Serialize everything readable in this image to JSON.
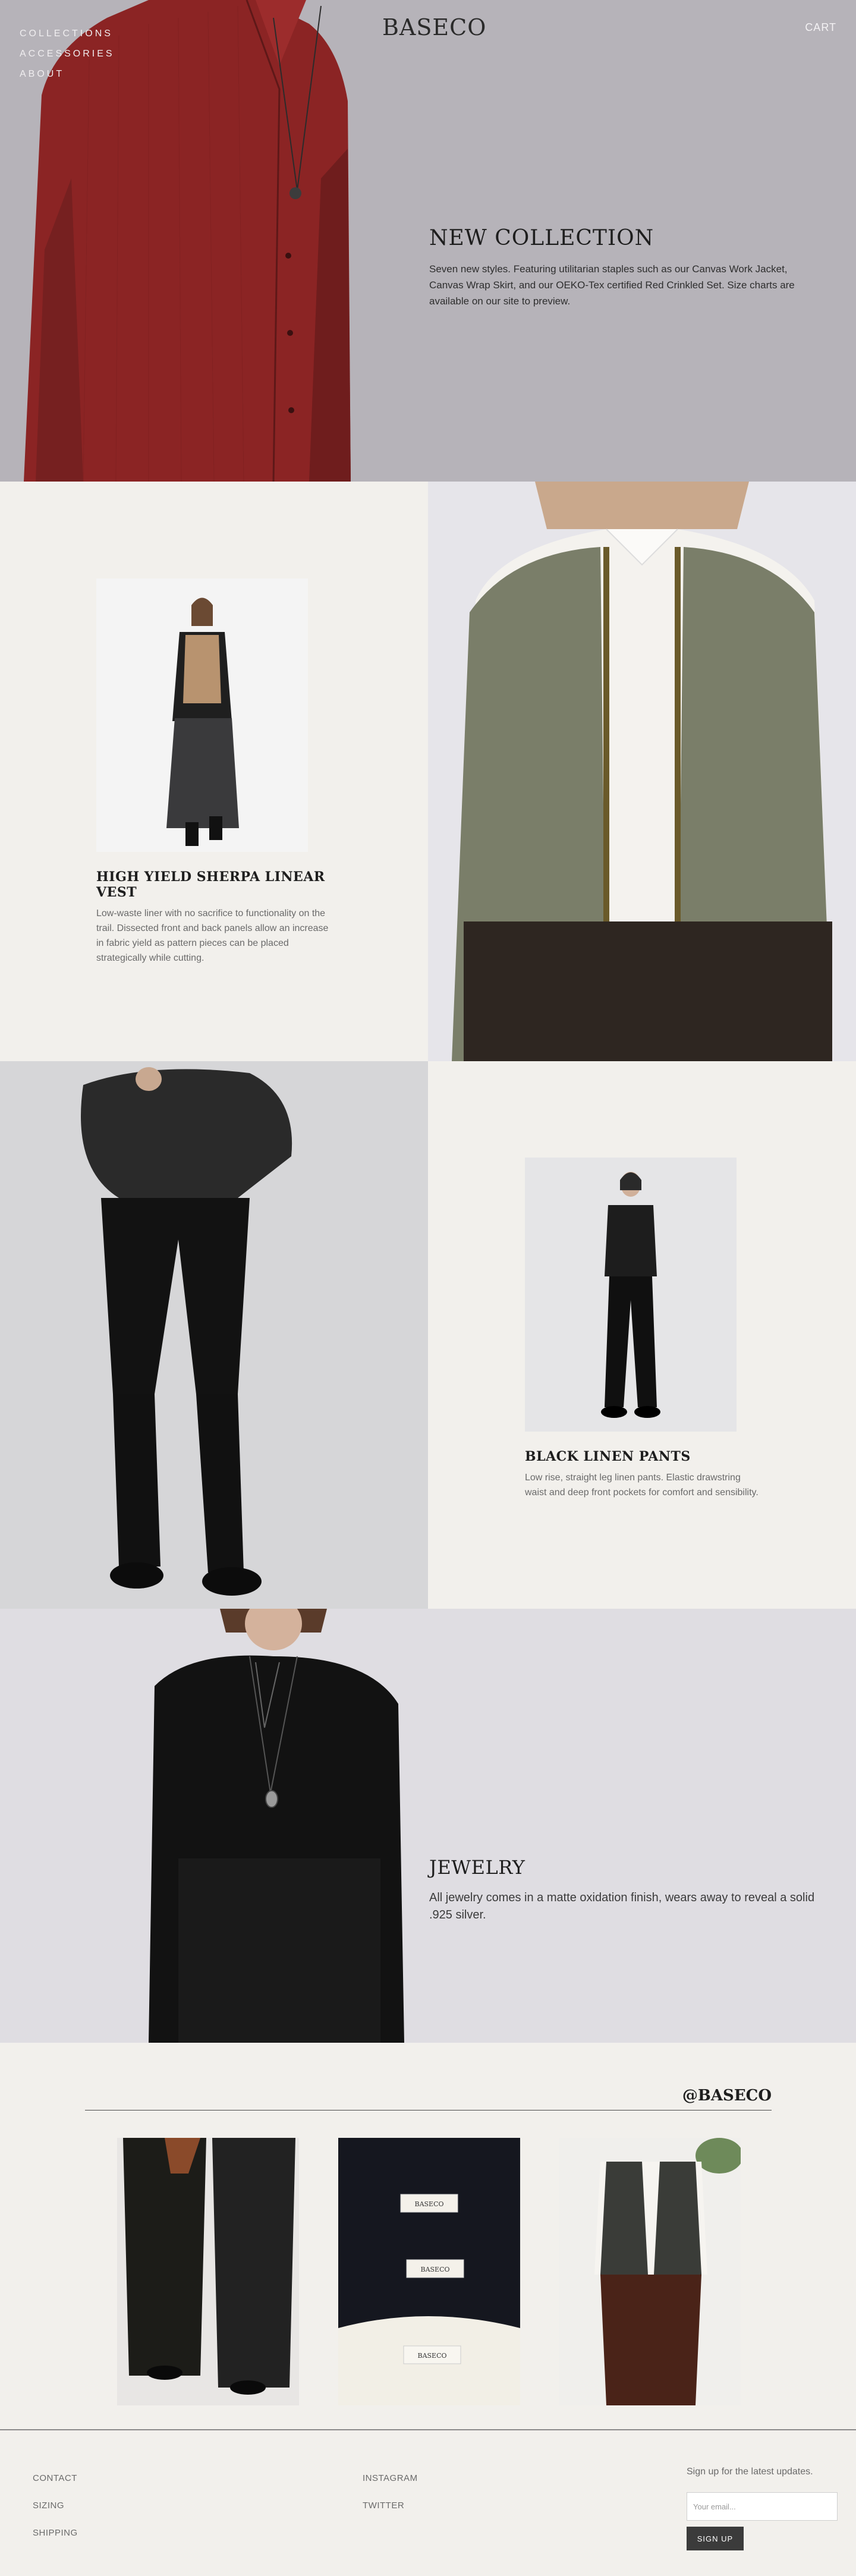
{
  "nav": {
    "links": [
      "COLLECTIONS",
      "ACCESSORIES",
      "ABOUT"
    ],
    "logo": "BASECO",
    "cart": "CART"
  },
  "hero": {
    "title": "NEW COLLECTION",
    "body": "Seven new styles. Featuring utilitarian staples such as our Canvas Work Jacket, Canvas Wrap Skirt, and our OEKO-Tex certified Red Crinkled Set. Size charts are available on our site to preview."
  },
  "features": [
    {
      "title": "HIGH YIELD SHERPA LINEAR VEST",
      "body": "Low-waste liner with no sacrifice to functionality on the trail. Dissected front and back panels allow an increase in fabric yield as pattern pieces can be placed strategically while cutting."
    },
    {
      "title": "BLACK LINEN PANTS",
      "body": "Low rise, straight leg linen pants. Elastic drawstring waist and deep front pockets for comfort and sensibility."
    }
  ],
  "jewelry": {
    "title": "JEWELRY",
    "body": "All jewelry comes in a matte oxidation finish, wears away to reveal a solid .925 silver."
  },
  "instagram": {
    "handle": "@BASECO",
    "label_text": "BASECO"
  },
  "footer": {
    "col1": [
      "CONTACT",
      "SIZING",
      "SHIPPING"
    ],
    "col2": [
      "INSTAGRAM",
      "TWITTER"
    ],
    "signup_text": "Sign up for the latest updates.",
    "email_placeholder": "Your email...",
    "signup_button": "SIGN UP"
  },
  "colors": {
    "page_bg": "#f2f0ec",
    "hero_bg": "#b6b3b9",
    "accent_red": "#8b2424",
    "button_dark": "#3b3b3b"
  }
}
